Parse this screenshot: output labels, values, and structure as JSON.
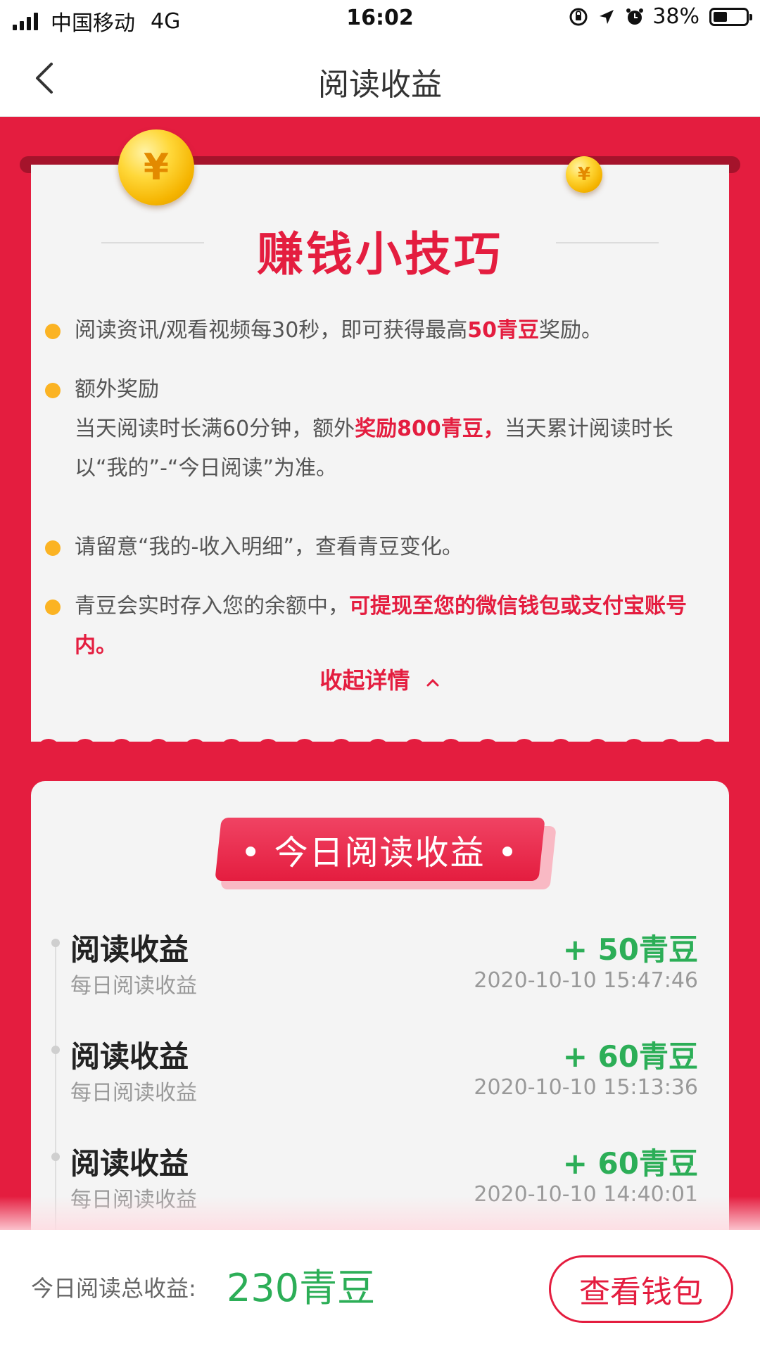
{
  "status_bar": {
    "carrier": "中国移动",
    "network": "4G",
    "time": "16:02",
    "battery": "38%",
    "icons": [
      "signal-icon",
      "orientation-lock-icon",
      "location-icon",
      "alarm-icon",
      "battery-icon"
    ]
  },
  "nav": {
    "title": "阅读收益",
    "back_icon": "chevron-left-icon"
  },
  "tips": {
    "heading": "赚钱小技巧",
    "items": [
      {
        "parts": [
          "阅读资讯/观看视频每30秒，即可获得最高",
          "50青豆",
          "奖励。"
        ]
      },
      {
        "title": "额外奖励",
        "parts": [
          "当天阅读时长满60分钟，额外",
          "奖励800青豆，",
          "当天累计阅读时长以“我的”-“今日阅读”为准。"
        ]
      },
      {
        "parts": [
          "请留意“我的-收入明细”，查看青豆变化。"
        ]
      },
      {
        "parts": [
          "青豆会实时存入您的余额中，",
          "可提现至您的微信钱包或支付宝账号内。"
        ]
      }
    ],
    "collapse_label": "收起详情",
    "coin_symbol": "¥"
  },
  "income": {
    "title": "• 今日阅读收益 •",
    "records": [
      {
        "name": "阅读收益",
        "sub": "每日阅读收益",
        "amount": "+ 50青豆",
        "time": "2020-10-10 15:47:46"
      },
      {
        "name": "阅读收益",
        "sub": "每日阅读收益",
        "amount": "+ 60青豆",
        "time": "2020-10-10 15:13:36"
      },
      {
        "name": "阅读收益",
        "sub": "每日阅读收益",
        "amount": "+ 60青豆",
        "time": "2020-10-10 14:40:01"
      }
    ]
  },
  "footer": {
    "total_label": "今日阅读总收益:",
    "total_value": "230青豆",
    "wallet_button": "查看钱包"
  },
  "colors": {
    "brand_red": "#e41d3f",
    "green": "#2cae57",
    "bullet_yellow": "#fbb323"
  }
}
